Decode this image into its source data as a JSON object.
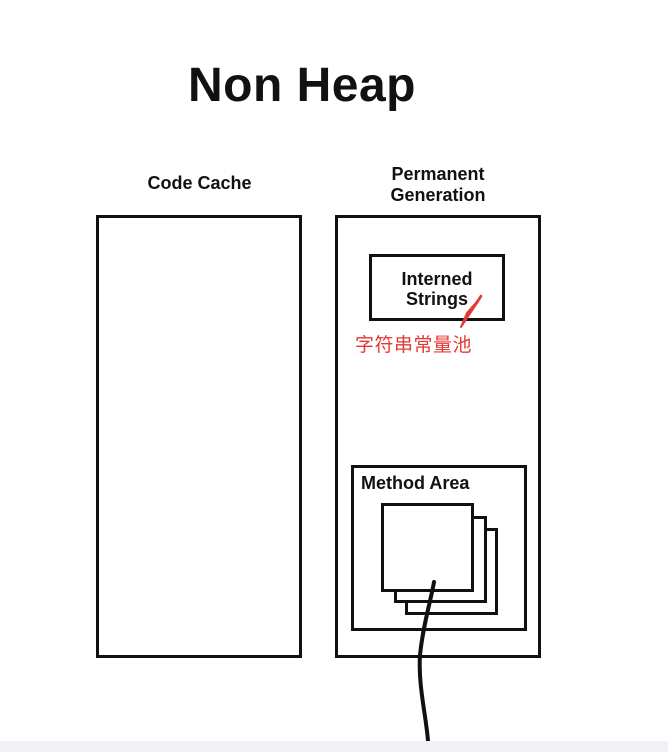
{
  "diagram": {
    "title": "Non Heap",
    "code_cache": {
      "label": "Code Cache"
    },
    "permanent_generation": {
      "label_line1": "Permanent",
      "label_line2": "Generation",
      "interned_strings": {
        "label_line1": "Interned",
        "label_line2": "Strings"
      },
      "method_area": {
        "label": "Method Area"
      }
    },
    "annotation": {
      "text": "字符串常量池",
      "color": "#e53935"
    }
  }
}
